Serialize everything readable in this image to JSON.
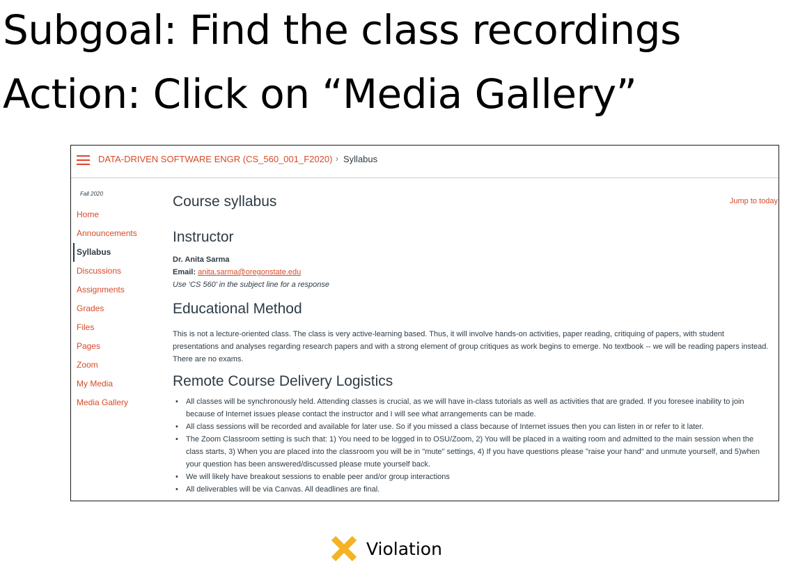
{
  "slide": {
    "subgoal": "Subgoal: Find the class recordings",
    "action": "Action: Click on “Media Gallery”",
    "verdict": "Violation",
    "verdict_icon": "x-mark-icon",
    "verdict_color": "#f5b324"
  },
  "canvas": {
    "accent_color": "#d64a26",
    "breadcrumb": {
      "course": "DATA-DRIVEN SOFTWARE ENGR (CS_560_001_F2020)",
      "separator": "›",
      "current": "Syllabus"
    },
    "sidebar": {
      "term": "Fall 2020",
      "items": [
        {
          "label": "Home"
        },
        {
          "label": "Announcements"
        },
        {
          "label": "Syllabus",
          "active": true
        },
        {
          "label": "Discussions"
        },
        {
          "label": "Assignments"
        },
        {
          "label": "Grades"
        },
        {
          "label": "Files"
        },
        {
          "label": "Pages"
        },
        {
          "label": "Zoom"
        },
        {
          "label": "My Media"
        },
        {
          "label": "Media Gallery"
        }
      ]
    },
    "content": {
      "page_heading": "Course syllabus",
      "jump_link": "Jump to today",
      "instructor": {
        "heading": "Instructor",
        "name": "Dr. Anita Sarma",
        "email_label": "Email:",
        "email": "anita.sarma@oregonstate.edu",
        "note": "Use ‘CS 560’ in the subject line for a response"
      },
      "method": {
        "heading": "Educational Method",
        "text": "This is not a lecture-oriented class. The class is very active-learning based. Thus, it will involve hands-on activities, paper reading, critiquing of papers, with student presentations and analyses regarding research papers and with a strong element of group critiques as work begins to emerge. No textbook -- we will be reading papers instead. There are no exams."
      },
      "remote": {
        "heading": "Remote Course Delivery Logistics",
        "bullets": [
          "All classes will be synchronously held. Attending classes is crucial, as we will have in-class tutorials as well as activities that are graded. If you foresee inability to join because of Internet issues please contact the instructor and I will see what arrangements can be made.",
          "All class sessions will be recorded and available for later use. So if you missed a class because of Internet issues then you can listen in or refer to it later.",
          "The Zoom Classroom setting is such that: 1) You need to be logged in to OSU/Zoom, 2) You will be placed in a waiting room and admitted to the main session when the class starts, 3) When you are placed into the classroom you will be in \"mute\" settings, 4) If you have questions please \"raise your hand\" and unmute yourself, and 5)when your question has been answered/discussed please mute yourself back.",
          "We will likely have breakout sessions to enable peer and/or group interactions",
          "All deliverables will be via Canvas. All deadlines are final."
        ]
      }
    }
  }
}
